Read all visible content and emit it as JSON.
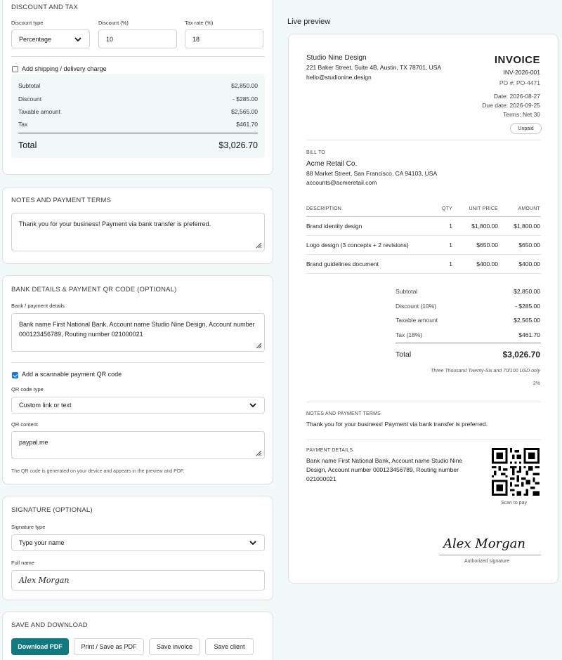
{
  "discount_tax": {
    "title": "DISCOUNT AND TAX",
    "discount_type_label": "Discount type",
    "discount_type_value": "Percentage",
    "discount_pct_label": "Discount (%)",
    "discount_pct_value": "10",
    "tax_rate_label": "Tax rate (%)",
    "tax_rate_value": "18",
    "shipping_label": "Add shipping / delivery charge",
    "totals": [
      {
        "label": "Subtotal",
        "value": "$2,850.00"
      },
      {
        "label": "Discount",
        "value": "- $285.00"
      },
      {
        "label": "Taxable amount",
        "value": "$2,565.00"
      },
      {
        "label": "Tax",
        "value": "$461.70"
      }
    ],
    "total_label": "Total",
    "total_value": "$3,026.70"
  },
  "notes": {
    "title": "NOTES AND PAYMENT TERMS",
    "value": "Thank you for your business! Payment via bank transfer is preferred."
  },
  "bank": {
    "title": "BANK DETAILS & PAYMENT QR CODE (OPTIONAL)",
    "details_label": "Bank / payment details",
    "details_value": "Bank name First National Bank, Account name Studio Nine Design, Account number 000123456789, Routing number 021000021",
    "qr_checkbox_label": "Add a scannable payment QR code",
    "qr_type_label": "QR code type",
    "qr_type_value": "Custom link or text",
    "qr_content_label": "QR content",
    "qr_content_value": "paypal.me",
    "qr_hint": "The QR code is generated on your device and appears in the preview and PDF."
  },
  "signature": {
    "title": "SIGNATURE (OPTIONAL)",
    "type_label": "Signature type",
    "type_value": "Type your name",
    "name_label": "Full name",
    "name_value": "Alex Morgan"
  },
  "save": {
    "title": "SAVE AND DOWNLOAD",
    "download_pdf": "Download PDF",
    "print": "Print / Save as PDF",
    "save_invoice": "Save invoice",
    "save_client": "Save client"
  },
  "preview": {
    "label": "Live preview",
    "from_name": "Studio Nine Design",
    "from_address": "221 Baker Street, Suite 4B, Austin, TX 78701, USA",
    "from_email": "hello@studionine.design",
    "invoice_title": "INVOICE",
    "invoice_number": "INV-2026-001",
    "po": "PO #: PO-4471",
    "date": "Date: 2026-08-27",
    "due_date": "Due date: 2026-09-25",
    "terms": "Terms: Net 30",
    "status": "Unpaid",
    "bill_to_label": "BILL TO",
    "client_name": "Acme Retail Co.",
    "client_address": "88 Market Street, San Francisco, CA 94103, USA",
    "client_email": "accounts@acmeretail.com",
    "headers": {
      "description": "DESCRIPTION",
      "qty": "QTY",
      "unit_price": "UNIT PRICE",
      "amount": "AMOUNT"
    },
    "items": [
      {
        "description": "Brand identity design",
        "qty": "1",
        "unit_price": "$1,800.00",
        "amount": "$1,800.00"
      },
      {
        "description": "Logo design (3 concepts + 2 revisions)",
        "qty": "1",
        "unit_price": "$650.00",
        "amount": "$650.00"
      },
      {
        "description": "Brand guidelines document",
        "qty": "1",
        "unit_price": "$400.00",
        "amount": "$400.00"
      }
    ],
    "totals": [
      {
        "label": "Subtotal",
        "value": "$2,850.00"
      },
      {
        "label": "Discount (10%)",
        "value": "- $285.00"
      },
      {
        "label": "Taxable amount",
        "value": "$2,565.00"
      },
      {
        "label": "Tax (18%)",
        "value": "$461.70"
      }
    ],
    "total_label": "Total",
    "total_value": "$3,026.70",
    "amount_words": "Three Thousand Twenty-Six and 70/100 USD only",
    "pct": "2%",
    "notes_label": "NOTES AND PAYMENT TERMS",
    "notes_value": "Thank you for your business! Payment via bank transfer is preferred.",
    "payment_label": "PAYMENT DETAILS",
    "payment_value": "Bank name First National Bank, Account name Studio Nine Design, Account number 000123456789, Routing number 021000021",
    "scan_label": "Scan to pay",
    "signature_name": "Alex Morgan",
    "signature_caption": "Authorized signature"
  },
  "icons": [
    "chevron-down-icon",
    "resize-grip-icon",
    "check-icon",
    "qr-code-icon"
  ]
}
